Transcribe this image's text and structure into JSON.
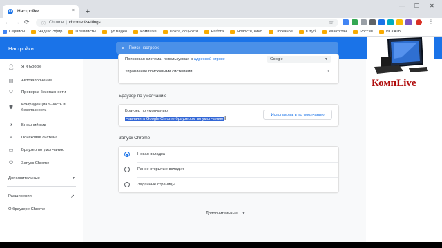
{
  "tab": {
    "title": "Настройки",
    "close": "×"
  },
  "new_tab": "+",
  "window": {
    "minimize": "—",
    "maximize": "❐",
    "close": "✕"
  },
  "toolbar": {
    "back": "←",
    "forward": "→",
    "reload": "⟳",
    "scheme": "Chrome",
    "url": "chrome://settings",
    "star": "☆"
  },
  "bookmarks": [
    {
      "label": "Сервисы",
      "icon": "apps-icon",
      "color": "#4285f4"
    },
    {
      "label": "Яндекс Эфир",
      "icon": "folder-icon",
      "color": "#f9ab00"
    },
    {
      "label": "Плейлисты",
      "icon": "folder-icon",
      "color": "#f9ab00"
    },
    {
      "label": "Тут Видео",
      "icon": "folder-icon",
      "color": "#f9ab00"
    },
    {
      "label": "КомпLive",
      "icon": "folder-icon",
      "color": "#f9ab00"
    },
    {
      "label": "Почта, соц-сети",
      "icon": "folder-icon",
      "color": "#f9ab00"
    },
    {
      "label": "Работа",
      "icon": "folder-icon",
      "color": "#f9ab00"
    },
    {
      "label": "Новости, кино",
      "icon": "folder-icon",
      "color": "#f9ab00"
    },
    {
      "label": "Полезное",
      "icon": "folder-icon",
      "color": "#f9ab00"
    },
    {
      "label": "Ютуб",
      "icon": "folder-icon",
      "color": "#f9ab00"
    },
    {
      "label": "Казахстан",
      "icon": "folder-icon",
      "color": "#f9ab00"
    },
    {
      "label": "Россия",
      "icon": "folder-icon",
      "color": "#f9ab00"
    },
    {
      "label": "ИСКАТЬ",
      "icon": "folder-icon",
      "color": "#f9ab00"
    }
  ],
  "header": {
    "title": "Настройки",
    "search_placeholder": "Поиск настроек",
    "color": "#1a73e8"
  },
  "sidebar": {
    "items": [
      {
        "label": "Я и Google",
        "icon": "person-icon"
      },
      {
        "label": "Автозаполнение",
        "icon": "autofill-icon"
      },
      {
        "label": "Проверка безопасности",
        "icon": "shield-check-icon"
      },
      {
        "label": "Конфиденциальность и безопасность",
        "icon": "shield-icon"
      },
      {
        "label": "Внешний вид",
        "icon": "palette-icon"
      },
      {
        "label": "Поисковая система",
        "icon": "search-icon"
      },
      {
        "label": "Браузер по умолчанию",
        "icon": "browser-icon"
      },
      {
        "label": "Запуск Chrome",
        "icon": "power-icon"
      }
    ],
    "advanced": "Дополнительные",
    "extensions": "Расширения",
    "about": "О браузере Chrome"
  },
  "search_engine": {
    "row_prefix": "Поисковая система, используемая в",
    "row_link": "адресной строке",
    "selected": "Google",
    "manage": "Управление поисковыми системами"
  },
  "default_browser": {
    "section_title": "Браузер по умолчанию",
    "label": "Браузер по умолчанию",
    "action": "Назначить Google Chrome браузером по умолчанию",
    "button": "Использовать по умолчанию"
  },
  "startup": {
    "section_title": "Запуск Chrome",
    "options": [
      {
        "label": "Новая вкладка",
        "checked": true
      },
      {
        "label": "Ранее открытые вкладки",
        "checked": false
      },
      {
        "label": "Заданные страницы",
        "checked": false
      }
    ]
  },
  "advanced_footer": "Дополнительные",
  "brand_logo": "КомпLive"
}
